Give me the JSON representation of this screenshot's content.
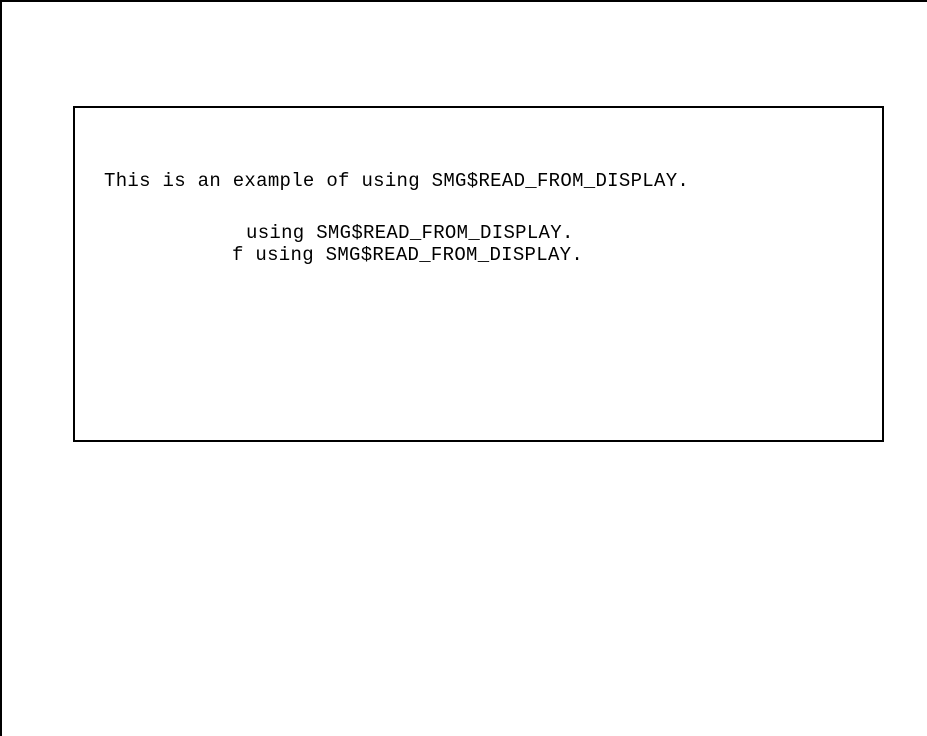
{
  "display": {
    "lines": [
      "This is an example of using SMG$READ_FROM_DISPLAY.",
      "using SMG$READ_FROM_DISPLAY.",
      "f using SMG$READ_FROM_DISPLAY."
    ]
  },
  "colors": {
    "background": "#ffffff",
    "foreground": "#000000",
    "border": "#000000"
  }
}
